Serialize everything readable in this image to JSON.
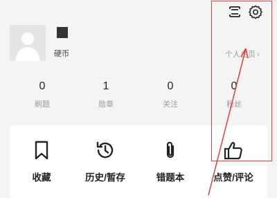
{
  "topbar": {
    "icons": [
      "scan-list-icon",
      "gear-icon"
    ]
  },
  "profile": {
    "badge": "硬币",
    "profile_link": "个人主页",
    "profile_link_chevron": "›"
  },
  "stats": [
    {
      "value": "0",
      "label": "刷题"
    },
    {
      "value": "1",
      "label": "勋章"
    },
    {
      "value": "0",
      "label": "关注"
    },
    {
      "value": "0",
      "label": "粉丝"
    }
  ],
  "actions": [
    {
      "label": "收藏",
      "icon": "bookmark-icon"
    },
    {
      "label": "历史/暂存",
      "icon": "history-icon"
    },
    {
      "label": "错题本",
      "icon": "paperclip-icon"
    },
    {
      "label": "点赞/评论",
      "icon": "thumbs-up-icon"
    }
  ],
  "annotation": {
    "color": "#e23b3b"
  }
}
